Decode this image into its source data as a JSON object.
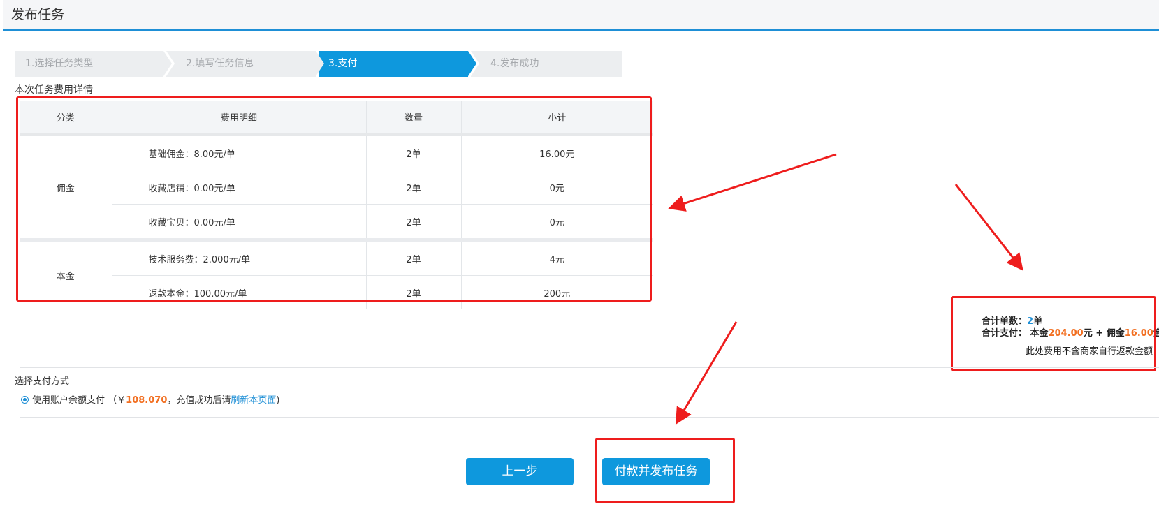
{
  "header": {
    "title": "发布任务"
  },
  "steps": [
    {
      "label": "1.选择任务类型",
      "active": false
    },
    {
      "label": "2.填写任务信息",
      "active": false
    },
    {
      "label": "3.支付",
      "active": true
    },
    {
      "label": "4.发布成功",
      "active": false
    }
  ],
  "fee_section": {
    "label": "本次任务费用详情",
    "columns": [
      "分类",
      "费用明细",
      "数量",
      "小计"
    ],
    "groups": [
      {
        "category": "佣金",
        "rows": [
          {
            "detail": "基础佣金：8.00元/单",
            "qty": "2单",
            "subtotal": "16.00元"
          },
          {
            "detail": "收藏店铺：0.00元/单",
            "qty": "2单",
            "subtotal": "0元"
          },
          {
            "detail": "收藏宝贝：0.00元/单",
            "qty": "2单",
            "subtotal": "0元"
          }
        ]
      },
      {
        "category": "本金",
        "rows": [
          {
            "detail": "技术服务费：2.000元/单",
            "qty": "2单",
            "subtotal": "4元"
          },
          {
            "detail": "返款本金：100.00元/单",
            "qty": "2单",
            "subtotal": "200元"
          }
        ]
      }
    ]
  },
  "summary": {
    "count_label": "合计单数：",
    "count_value": "2",
    "count_unit": "单",
    "pay_label": "合计支付：",
    "principal_prefix": "本金",
    "principal_value": "204.00",
    "principal_unit": "元",
    "plus": "+",
    "commission_prefix": "佣金",
    "commission_value": "16.00",
    "commission_unit": "金",
    "note": "此处费用不含商家自行返款金额"
  },
  "payment": {
    "label": "选择支付方式",
    "option_text": "使用账户余额支付",
    "open_paren": "（￥",
    "balance": "108.070",
    "middle_text": "，充值成功后请",
    "refresh_link": "刷新本页面",
    "close_paren": ")"
  },
  "buttons": {
    "prev": "上一步",
    "pay": "付款并发布任务"
  },
  "colors": {
    "accent": "#0e98dd",
    "annotation": "#ee1d1d",
    "highlight": "#f26f21"
  }
}
